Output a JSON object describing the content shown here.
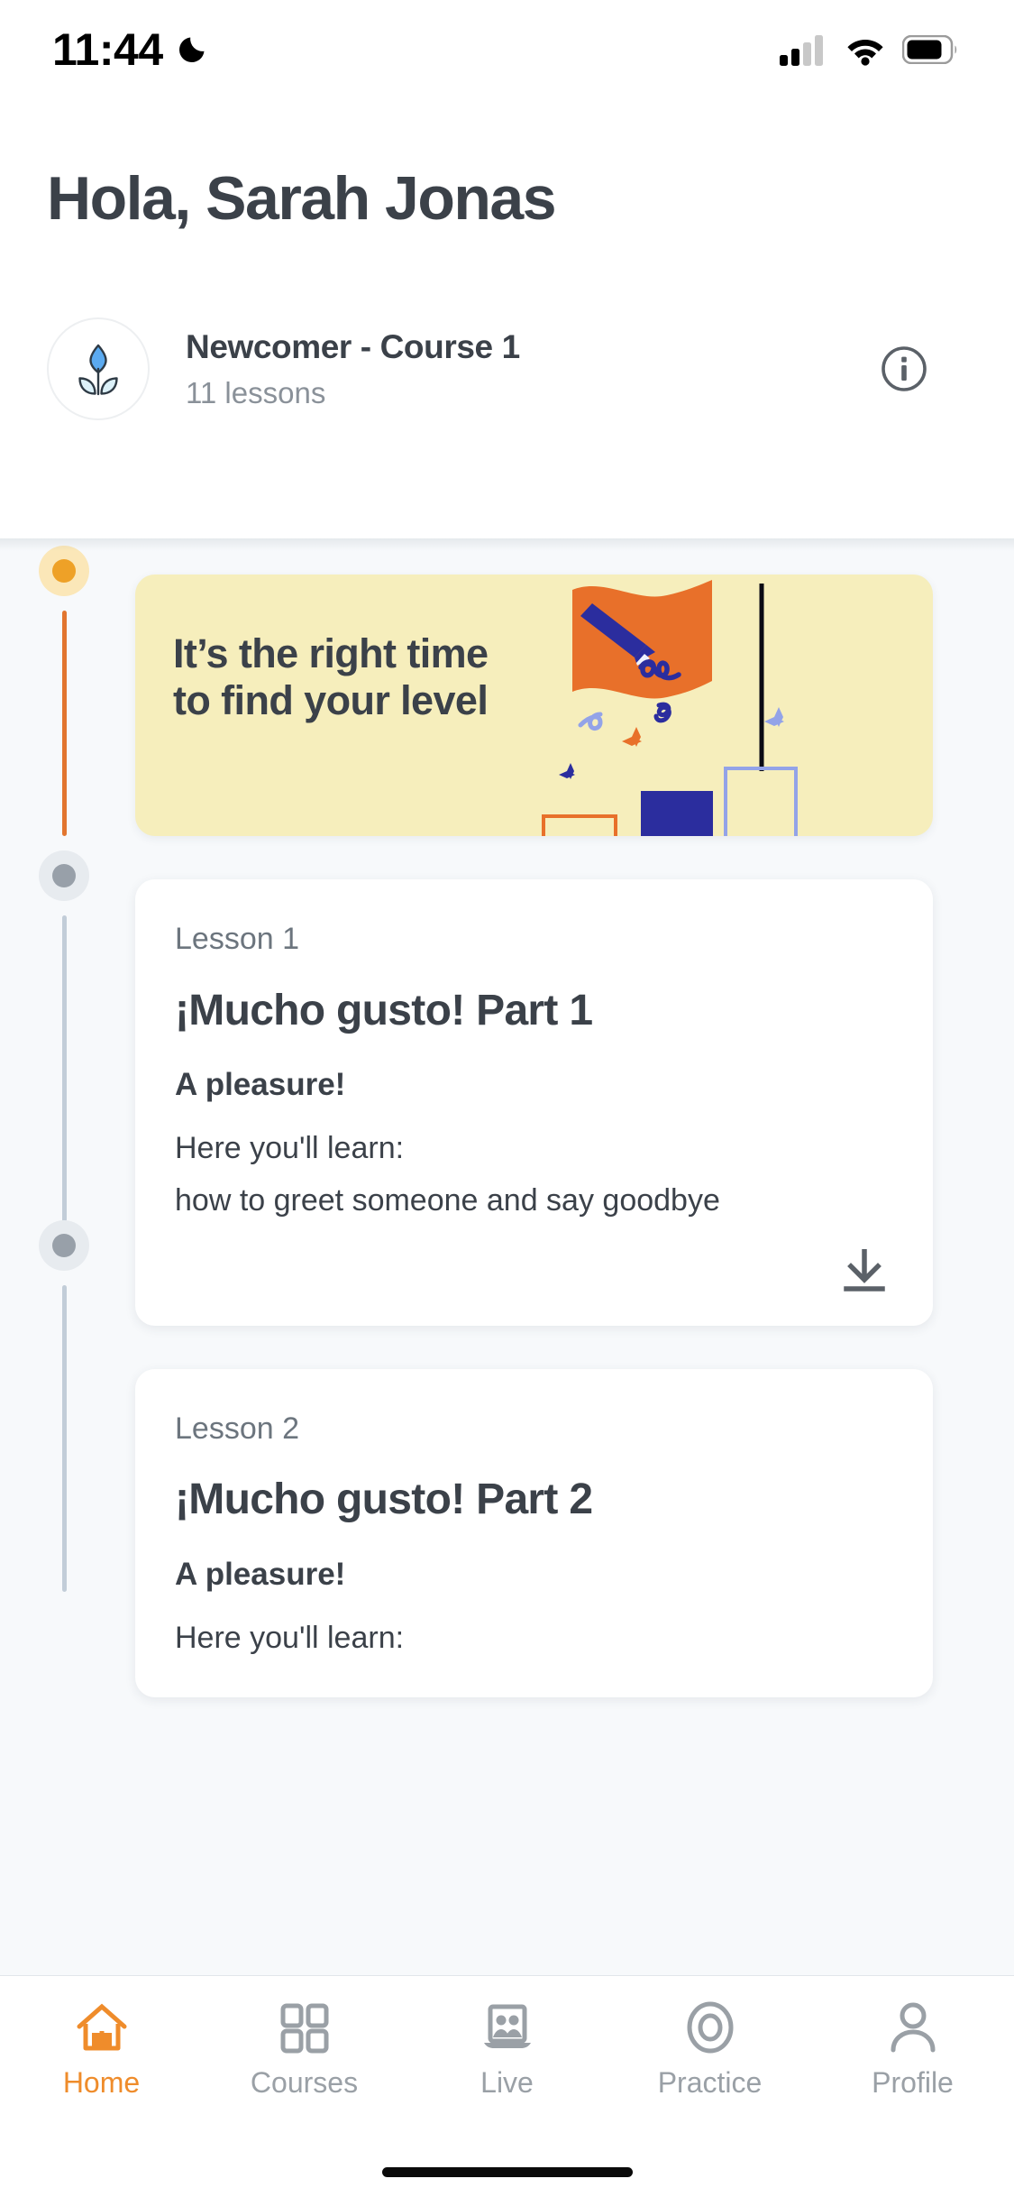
{
  "status_bar": {
    "time": "11:44",
    "dnd_icon": "crescent-moon-icon",
    "cellular_icon": "cellular-signal-icon",
    "wifi_icon": "wifi-icon",
    "battery_icon": "battery-icon"
  },
  "header": {
    "greeting": "Hola, Sarah Jonas",
    "avatar_icon": "sprout-plant-icon",
    "course_title": "Newcomer - Course 1",
    "course_subtitle": "11 lessons",
    "info_icon": "info-circle-icon"
  },
  "promo": {
    "text": "It’s the right time to find your level",
    "illustration": "flag-pencil-podium-illustration",
    "colors": {
      "background": "#F6EEBC",
      "flag": "#E8702A",
      "pencil": "#2B2D9E",
      "bar_solid": "#2B2D9E",
      "bar_outline_orange": "#E8702A",
      "bar_outline_blue": "#93A3E8",
      "pole": "#0B0B14"
    }
  },
  "lessons": [
    {
      "label": "Lesson 1",
      "title": "¡Mucho gusto! Part 1",
      "subtitle": "A pleasure!",
      "intro": "Here you'll learn:",
      "description": "how to greet someone and say goodbye",
      "download_icon": "download-icon"
    },
    {
      "label": "Lesson 2",
      "title": "¡Mucho gusto! Part 2",
      "subtitle": "A pleasure!",
      "intro": "Here you'll learn:",
      "description": "",
      "download_icon": "download-icon"
    }
  ],
  "timeline": {
    "active_color": "#EEA127",
    "active_ring": "#FBE7B8",
    "active_line": "#E2762F",
    "idle_color": "#98A0A9",
    "idle_ring": "#E7EBEF",
    "idle_line": "#C2CDD8"
  },
  "tab_bar": {
    "accent_color": "#EF8C2B",
    "inactive_color": "#9AA0A6",
    "items": [
      {
        "label": "Home",
        "icon": "home-icon",
        "active": true
      },
      {
        "label": "Courses",
        "icon": "grid-icon",
        "active": false
      },
      {
        "label": "Live",
        "icon": "live-people-screen-icon",
        "active": false
      },
      {
        "label": "Practice",
        "icon": "target-icon",
        "active": false
      },
      {
        "label": "Profile",
        "icon": "person-icon",
        "active": false
      }
    ]
  }
}
